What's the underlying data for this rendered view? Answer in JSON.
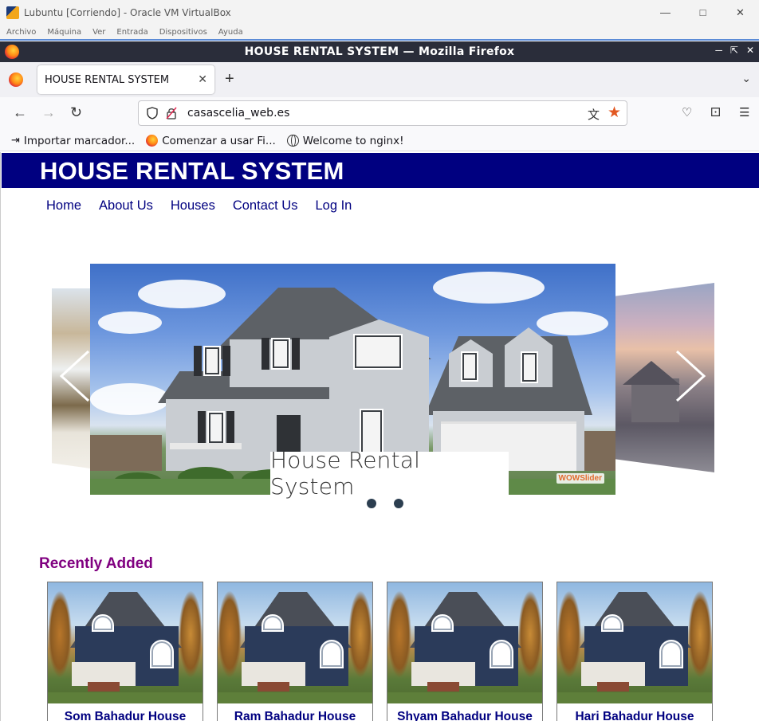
{
  "vbox": {
    "title": "Lubuntu [Corriendo] - Oracle VM VirtualBox",
    "menu": [
      "Archivo",
      "Máquina",
      "Ver",
      "Entrada",
      "Dispositivos",
      "Ayuda"
    ]
  },
  "firefox": {
    "window_title": "HOUSE RENTAL SYSTEM — Mozilla Firefox",
    "tab_title": "HOUSE RENTAL SYSTEM",
    "url": "casascelia_web.es",
    "bookmarks": [
      "Importar marcador...",
      "Comenzar a usar Fi...",
      "Welcome to nginx!"
    ]
  },
  "site": {
    "title": "HOUSE RENTAL SYSTEM",
    "nav": [
      "Home",
      "About Us",
      "Houses",
      "Contact Us",
      "Log In"
    ],
    "slider": {
      "caption": "House Rental System",
      "watermark": "WOWSlider",
      "slide_count": 2
    },
    "recent_title": "Recently Added",
    "houses": [
      "Som Bahadur House",
      "Ram Bahadur House",
      "Shyam Bahadur House",
      "Hari Bahadur House"
    ]
  },
  "colors": {
    "header_bg": "#000080",
    "nav_link": "#000080",
    "recent_title": "#800080",
    "firefox_star": "#e25822"
  }
}
